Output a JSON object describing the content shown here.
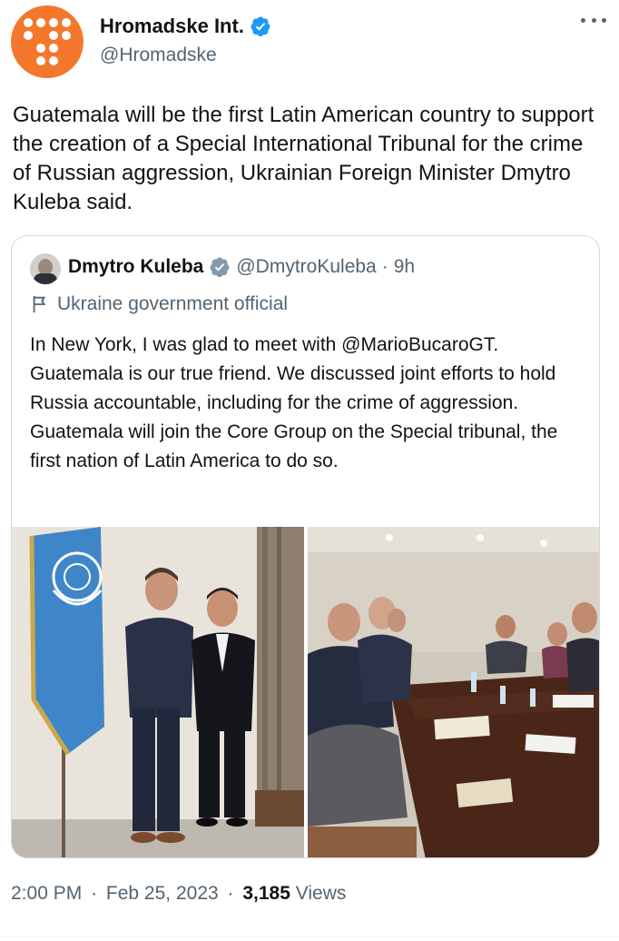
{
  "tweet": {
    "author": {
      "display_name": "Hromadske Int.",
      "handle": "@Hromadske",
      "avatar_color": "#f4782b",
      "verified": true
    },
    "text": "Guatemala will be the first Latin American country to support the creation of a Special International Tribunal for the crime of Russian aggression, Ukrainian Foreign Minister Dmytro Kuleba said.",
    "time": "2:00 PM",
    "separator": "·",
    "date": "Feb 25, 2023",
    "views_count": "3,185",
    "views_label": "Views"
  },
  "quoted_tweet": {
    "author": {
      "display_name": "Dmytro Kuleba",
      "handle": "@DmytroKuleba",
      "age": "9h",
      "verified_badge_color": "#829aab"
    },
    "affiliation": "Ukraine government official",
    "text": "In New York, I was glad to meet with @MarioBucaroGT. Guatemala is our true friend. We discussed joint efforts to hold Russia accountable, including for the crime of aggression. Guatemala will join the Core Group on the Special tribunal, the first nation of Latin America to do so.",
    "media_count": 2
  },
  "colors": {
    "text_primary": "#0f1419",
    "text_secondary": "#536471",
    "verified_blue": "#1d9bf0",
    "border": "#cfd9de"
  },
  "icons": [
    "more-icon",
    "verified-badge-icon",
    "government-verified-badge-icon",
    "government-flag-icon"
  ]
}
